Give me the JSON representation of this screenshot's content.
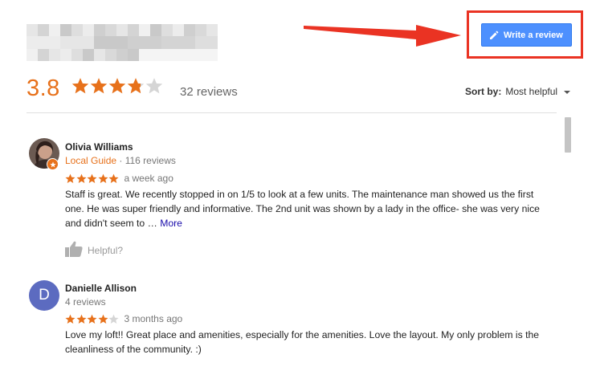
{
  "header": {
    "rating": "3.8",
    "rating_value": 3.8,
    "review_count": "32 reviews",
    "write_review_label": "Write a review",
    "sort_label": "Sort by:",
    "sort_value": "Most helpful"
  },
  "colors": {
    "accent_orange": "#e7711b",
    "button_blue": "#4d90fe",
    "highlight_red": "#ea3323",
    "link_blue": "#1a0dab"
  },
  "reviews": [
    {
      "name": "Olivia Williams",
      "local_guide": "Local Guide",
      "meta_rest": "· 116 reviews",
      "stars": 5,
      "time": "a week ago",
      "text": "Staff is great. We recently stopped in on 1/5 to look at a few units. The maintenance man showed us the first one. He was super friendly and informative. The 2nd unit was shown by a lady in the office- she was very nice and didn't seem to …",
      "more_label": "More",
      "helpful_label": "Helpful?"
    },
    {
      "name": "Danielle Allison",
      "avatar_letter": "D",
      "meta": "4 reviews",
      "stars": 4,
      "time": "3 months ago",
      "text": "Love my loft!! Great place and amenities, especially for the amenities. Love the layout. My only problem is the cleanliness of the community. :)"
    }
  ]
}
